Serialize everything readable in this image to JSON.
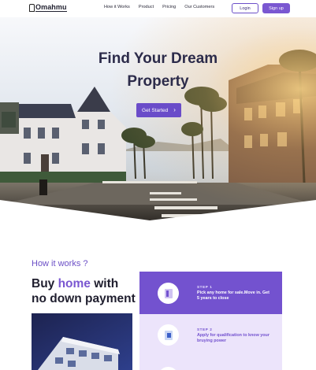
{
  "brand": {
    "name": "Omahmu"
  },
  "nav": {
    "links": [
      "How it Works",
      "Product",
      "Pricing",
      "Our Customers"
    ],
    "login_label": "Login",
    "signup_label": "Sign up"
  },
  "hero": {
    "title_line1": "Find Your Dream",
    "title_line2": "Property",
    "cta_label": "Get Started"
  },
  "how": {
    "label": "How it works ?",
    "title_pre": "Buy ",
    "title_highlight": "home",
    "title_post": " with",
    "title_line2": "no down payment"
  },
  "steps": [
    {
      "kicker": "STEP 1",
      "text": "Pick any home for sale.Move in. Get 5 years to close"
    },
    {
      "kicker": "STEP 2",
      "text": "Apply for qualification to know your bruying power"
    }
  ],
  "colors": {
    "accent": "#7a57d1",
    "step1_bg": "#7352cf",
    "step2_bg": "#ece4fb",
    "heading": "#2c2b4a"
  }
}
